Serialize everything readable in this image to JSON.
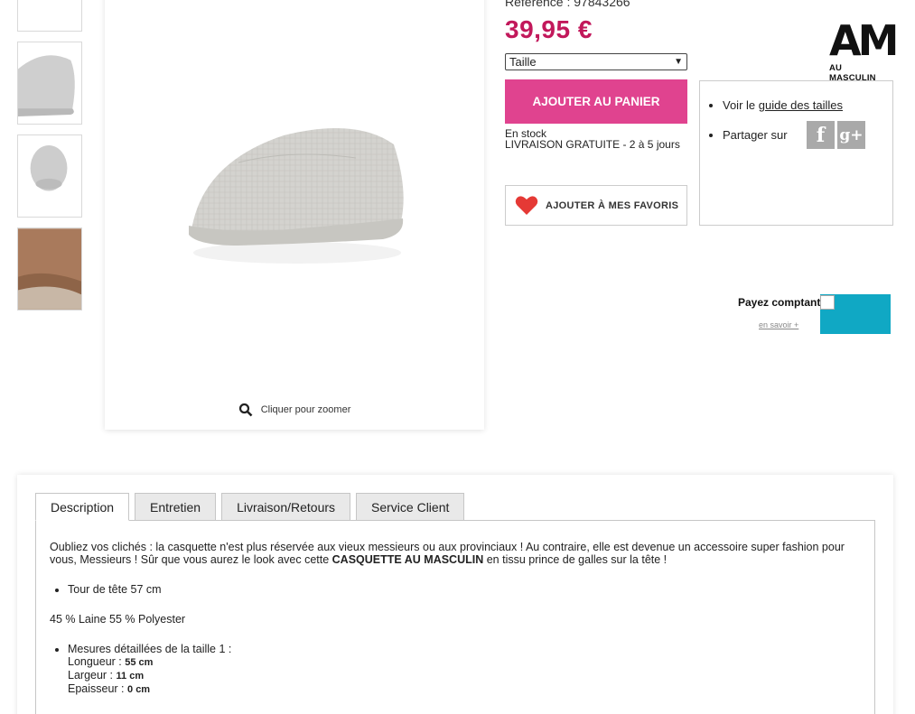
{
  "product": {
    "reference": "Référence : 97843266",
    "price": "39,95 €",
    "size_select": "Taille",
    "add_to_cart": "AJOUTER AU PANIER",
    "stock": "En stock",
    "delivery": "LIVRAISON GRATUITE - 2 à 5 jours",
    "add_favorites": "AJOUTER À MES FAVORIS",
    "zoom_label": "Cliquer pour zoomer"
  },
  "brand": {
    "logo_letters": "AM",
    "name": "AU MASCULIN"
  },
  "info_box": {
    "size_guide_prefix": "Voir le ",
    "size_guide_link": "guide des tailles",
    "share_label": "Partager sur",
    "social": [
      "facebook-icon",
      "google-plus-icon"
    ],
    "facebook_glyph": "f",
    "gplus_glyph": "g+"
  },
  "payment": {
    "label": "Payez comptant",
    "more": "en savoir +"
  },
  "tabs": [
    {
      "label": "Description",
      "active": true
    },
    {
      "label": "Entretien",
      "active": false
    },
    {
      "label": "Livraison/Retours",
      "active": false
    },
    {
      "label": "Service Client",
      "active": false
    }
  ],
  "description": {
    "intro_before": "Oubliez vos clichés : la casquette n'est plus réservée aux vieux messieurs ou aux provinciaux ! Au contraire, elle est devenue un accessoire super fashion pour vous, Messieurs ! Sûr que vous aurez le look avec cette ",
    "intro_bold": "CASQUETTE AU MASCULIN",
    "intro_after": " en tissu prince de galles sur la tête !",
    "bullet_head": "Tour de tête 57 cm",
    "composition": "45 % Laine 55 % Polyester",
    "measures_title": "Mesures détaillées de la taille 1 :",
    "length_label": "Longueur : ",
    "length_value": "55 cm",
    "width_label": "Largeur : ",
    "width_value": "11 cm",
    "thickness_label": "Epaisseur : ",
    "thickness_value": "0 cm"
  },
  "colors": {
    "price": "#c2185b",
    "cart_button": "#e0438f",
    "heart": "#e53935",
    "payment_banner": "#10a8c4"
  }
}
